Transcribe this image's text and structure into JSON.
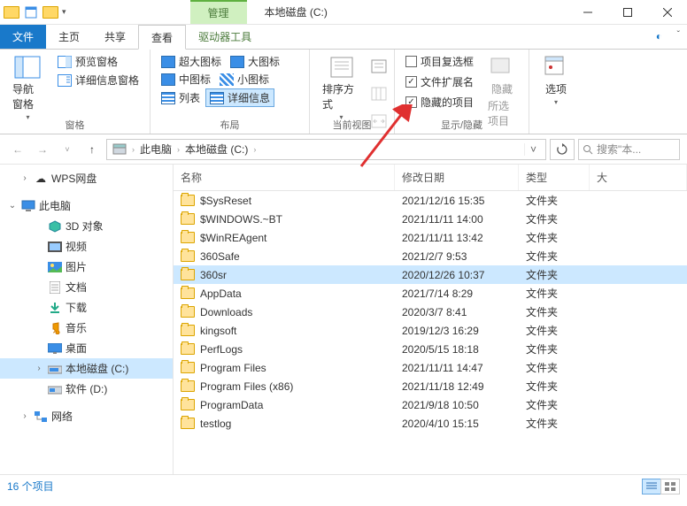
{
  "titlebar": {
    "manage_tab": "管理",
    "title": "本地磁盘 (C:)"
  },
  "tabs": {
    "file": "文件",
    "home": "主页",
    "share": "共享",
    "view": "查看",
    "drive_tools": "驱动器工具"
  },
  "ribbon": {
    "panes": {
      "nav_pane": "导航窗格",
      "preview_pane": "预览窗格",
      "details_pane": "详细信息窗格",
      "group": "窗格"
    },
    "layout": {
      "extra_large": "超大图标",
      "large": "大图标",
      "medium": "中图标",
      "small": "小图标",
      "list": "列表",
      "details": "详细信息",
      "group": "布局"
    },
    "current_view": {
      "sort_by": "排序方式",
      "group": "当前视图"
    },
    "show_hide": {
      "item_checkboxes": "项目复选框",
      "file_ext": "文件扩展名",
      "hidden_items": "隐藏的项目",
      "hide_btn": "隐藏",
      "hide_btn_sub": "所选项目",
      "group": "显示/隐藏"
    },
    "options": "选项"
  },
  "breadcrumb": {
    "pc": "此电脑",
    "drive": "本地磁盘 (C:)"
  },
  "search": {
    "placeholder": "搜索\"本..."
  },
  "sidebar": {
    "wps": "WPS网盘",
    "this_pc": "此电脑",
    "three_d": "3D 对象",
    "video": "视频",
    "pictures": "图片",
    "documents": "文档",
    "downloads": "下载",
    "music": "音乐",
    "desktop": "桌面",
    "c_drive": "本地磁盘 (C:)",
    "d_drive": "软件 (D:)",
    "network": "网络"
  },
  "columns": {
    "name": "名称",
    "date": "修改日期",
    "type": "类型",
    "size": "大"
  },
  "files": [
    {
      "name": "$SysReset",
      "date": "2021/12/16 15:35",
      "type": "文件夹"
    },
    {
      "name": "$WINDOWS.~BT",
      "date": "2021/11/11 14:00",
      "type": "文件夹"
    },
    {
      "name": "$WinREAgent",
      "date": "2021/11/11 13:42",
      "type": "文件夹"
    },
    {
      "name": "360Safe",
      "date": "2021/2/7 9:53",
      "type": "文件夹"
    },
    {
      "name": "360sr",
      "date": "2020/12/26 10:37",
      "type": "文件夹",
      "selected": true
    },
    {
      "name": "AppData",
      "date": "2021/7/14 8:29",
      "type": "文件夹"
    },
    {
      "name": "Downloads",
      "date": "2020/3/7 8:41",
      "type": "文件夹"
    },
    {
      "name": "kingsoft",
      "date": "2019/12/3 16:29",
      "type": "文件夹"
    },
    {
      "name": "PerfLogs",
      "date": "2020/5/15 18:18",
      "type": "文件夹"
    },
    {
      "name": "Program Files",
      "date": "2021/11/11 14:47",
      "type": "文件夹"
    },
    {
      "name": "Program Files (x86)",
      "date": "2021/11/18 12:49",
      "type": "文件夹"
    },
    {
      "name": "ProgramData",
      "date": "2021/9/18 10:50",
      "type": "文件夹"
    },
    {
      "name": "testlog",
      "date": "2020/4/10 15:15",
      "type": "文件夹"
    }
  ],
  "status": {
    "count": "16 个项目"
  },
  "checks": {
    "item_checkboxes": false,
    "file_ext": true,
    "hidden_items": true
  }
}
